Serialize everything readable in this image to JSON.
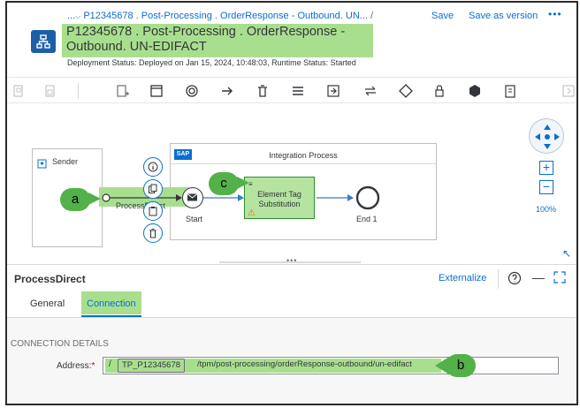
{
  "header": {
    "breadcrumb_prefix": "...",
    "breadcrumb_link": "P12345678 . Post-Processing . OrderResponse - Outbound. UN...",
    "breadcrumb_sep": "/",
    "title": "P12345678 . Post-Processing . OrderResponse - Outbound. UN-EDIFACT",
    "deploy_status": "Deployment Status: Deployed on Jan 15, 2024, 10:48:03, Runtime Status: Started",
    "save_label": "Save",
    "save_version_label": "Save as version",
    "more_label": "•••"
  },
  "canvas": {
    "sender_label": "Sender",
    "integration_process_label": "Integration Process",
    "sap_logo": "SAP",
    "process_direct_label": "ProcessDirect",
    "start_label": "Start",
    "element_tag_label": "Element Tag Substitution",
    "end_label": "End 1",
    "zoom_level": "100%",
    "callout_a": "a",
    "callout_b": "b",
    "callout_c": "c"
  },
  "panel": {
    "title": "ProcessDirect",
    "externalize_label": "Externalize",
    "tabs": [
      {
        "label": "General"
      },
      {
        "label": "Connection"
      }
    ],
    "section_heading": "CONNECTION DETAILS",
    "address_label": "Address:",
    "address_required": "*",
    "address_slash": "/",
    "address_param": "TP_P12345678",
    "address_path": "/tpm/post-processing/orderResponse-outbound/un-edifact"
  },
  "colors": {
    "accent": "#0a6ed1",
    "highlight": "#a8df8f",
    "callout": "#52b148"
  }
}
